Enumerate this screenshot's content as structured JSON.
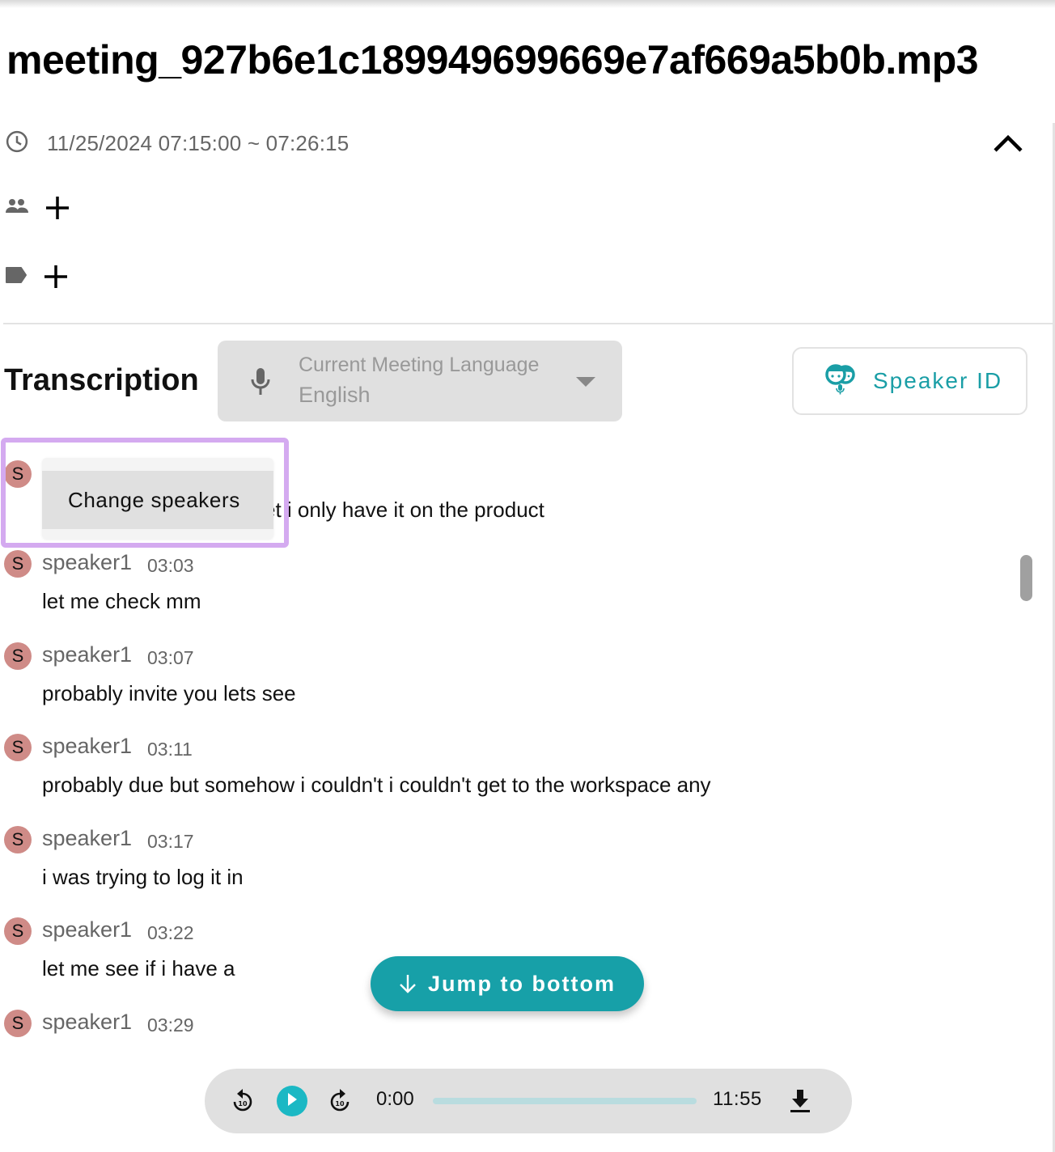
{
  "meeting": {
    "title": "meeting_927b6e1c189949699669e7af669a5b0b.mp3",
    "time_range": "11/25/2024 07:15:00 ~ 07:26:15",
    "icons": {
      "time": "clock-icon",
      "participants": "people-icon",
      "tags": "label-icon",
      "add": "plus-icon",
      "collapse": "chevron-up-icon"
    }
  },
  "transcription": {
    "heading": "Transcription",
    "language_select": {
      "label": "Current Meeting Language",
      "value": "English",
      "icon": "mic-icon"
    },
    "speaker_id_button": {
      "label": "Speaker ID",
      "icon": "speaker-id-icon"
    },
    "context_menu": {
      "items": [
        "Change speakers"
      ]
    },
    "entries": [
      {
        "avatar": "S",
        "speaker": "",
        "time": "",
        "text": "et i only have it on the product"
      },
      {
        "avatar": "S",
        "speaker": "speaker1",
        "time": "03:03",
        "text": "let me check mm"
      },
      {
        "avatar": "S",
        "speaker": "speaker1",
        "time": "03:07",
        "text": "probably invite you lets see"
      },
      {
        "avatar": "S",
        "speaker": "speaker1",
        "time": "03:11",
        "text": "probably due but somehow i couldn't i couldn't get to the workspace any"
      },
      {
        "avatar": "S",
        "speaker": "speaker1",
        "time": "03:17",
        "text": "i was trying to log it in"
      },
      {
        "avatar": "S",
        "speaker": "speaker1",
        "time": "03:22",
        "text": "let me see if i have a"
      },
      {
        "avatar": "S",
        "speaker": "speaker1",
        "time": "03:29",
        "text": ""
      }
    ],
    "jump_button": {
      "label": "Jump to bottom",
      "icon": "arrow-down-icon"
    }
  },
  "player": {
    "current_time": "0:00",
    "duration": "11:55",
    "progress_fraction": 0,
    "controls": [
      "rewind-10-icon",
      "play-icon",
      "forward-10-icon",
      "download-icon"
    ]
  },
  "colors": {
    "accent": "#17a0a8",
    "play": "#1bb8c4",
    "avatar": "#cf8b87",
    "highlight": "#d4aaf0"
  }
}
